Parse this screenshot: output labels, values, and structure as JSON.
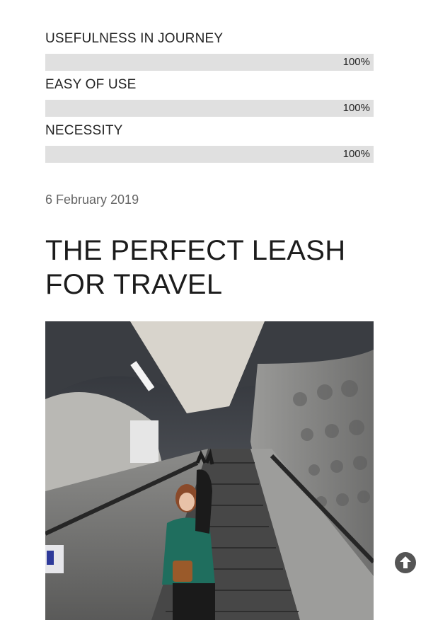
{
  "ratings": [
    {
      "label": "USEFULNESS IN JOURNEY",
      "value_text": "100%",
      "value": 100
    },
    {
      "label": "EASY OF USE",
      "value_text": "100%",
      "value": 100
    },
    {
      "label": "NECESSITY",
      "value_text": "100%",
      "value": 100
    }
  ],
  "post": {
    "date": "6 February 2019",
    "title": "THE PERFECT LEASH FOR TRAVEL"
  },
  "scroll_top": {
    "icon": "arrow-up-circle-icon"
  },
  "colors": {
    "bar": "#e0e0e0",
    "text": "#222222",
    "date": "#666666",
    "scroll_button": "#555555"
  }
}
